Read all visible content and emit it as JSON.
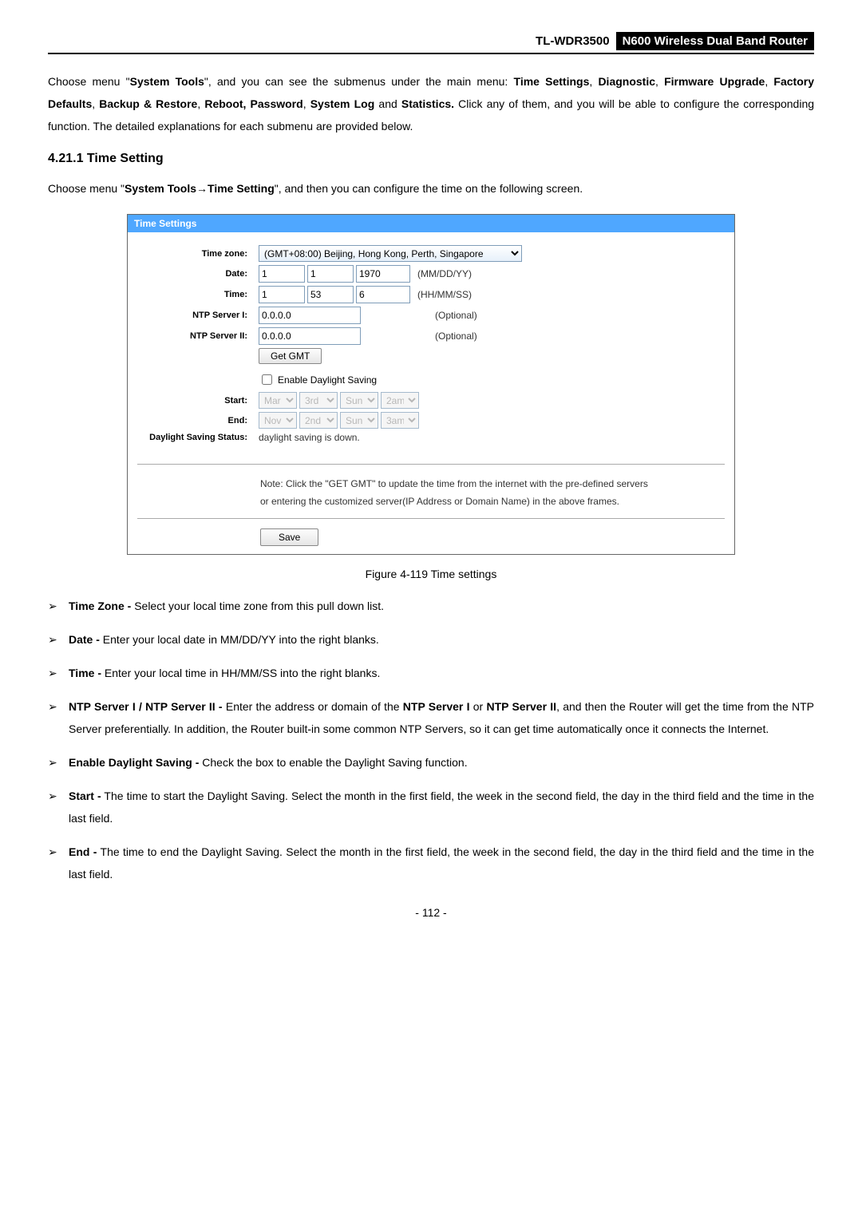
{
  "header": {
    "model": "TL-WDR3500",
    "product": "N600 Wireless Dual Band Router"
  },
  "intro": {
    "p1_a": "Choose menu \"",
    "p1_b": "System Tools",
    "p1_c": "\", and you can see the submenus under the main menu: ",
    "p1_d": "Time Settings",
    "p1_e": ", ",
    "p1_f": "Diagnostic",
    "p1_g": ", ",
    "p1_h": "Firmware Upgrade",
    "p1_i": ", ",
    "p1_j": "Factory Defaults",
    "p1_k": ", ",
    "p1_l": "Backup & Restore",
    "p1_m": ", ",
    "p1_n": "Reboot, Password",
    "p1_o": ", ",
    "p1_p": "System Log",
    "p1_q": " and ",
    "p1_r": "Statistics.",
    "p1_s": " Click any of them, and you will be able to configure the corresponding function. The detailed explanations for each submenu are provided below."
  },
  "section_heading": "4.21.1  Time Setting",
  "intro2_a": "Choose menu \"",
  "intro2_b": "System Tools",
  "intro2_arrow": "→",
  "intro2_c": "Time Setting",
  "intro2_d": "\", and then you can configure the time on the following screen.",
  "form": {
    "title": "Time Settings",
    "labels": {
      "timezone": "Time zone:",
      "date": "Date:",
      "time": "Time:",
      "ntp1": "NTP Server I:",
      "ntp2": "NTP Server II:",
      "start": "Start:",
      "end": "End:",
      "dss": "Daylight Saving Status:"
    },
    "timezone_value": "(GMT+08:00) Beijing, Hong Kong, Perth, Singapore",
    "date_mm": "1",
    "date_dd": "1",
    "date_yy": "1970",
    "date_fmt": "(MM/DD/YY)",
    "time_hh": "1",
    "time_mm": "53",
    "time_ss": "6",
    "time_fmt": "(HH/MM/SS)",
    "ntp1_val": "0.0.0.0",
    "ntp2_val": "0.0.0.0",
    "optional": "(Optional)",
    "get_gmt": "Get GMT",
    "enable_ds": "Enable Daylight Saving",
    "start_vals": {
      "m": "Mar",
      "w": "3rd",
      "d": "Sun",
      "t": "2am"
    },
    "end_vals": {
      "m": "Nov",
      "w": "2nd",
      "d": "Sun",
      "t": "3am"
    },
    "ds_status": "daylight saving is down.",
    "note1": "Note: Click the \"GET GMT\" to update the time from the internet with the pre-defined servers",
    "note2": "or entering the customized server(IP Address or Domain Name) in the above frames.",
    "save": "Save"
  },
  "caption": "Figure 4-119 Time settings",
  "bullets": {
    "b0_a": "Time Zone -",
    "b0_b": " Select your local time zone from this pull down list.",
    "b1_a": "Date -",
    "b1_b": " Enter your local date in MM/DD/YY into the right blanks.",
    "b2_a": "Time -",
    "b2_b": " Enter your local time in HH/MM/SS into the right blanks.",
    "b3_a": "NTP Server I / NTP Server II -",
    "b3_b": " Enter the address or domain of the ",
    "b3_c": "NTP Server I",
    "b3_d": " or ",
    "b3_e": "NTP Server II",
    "b3_f": ", and then the Router will get the time from the NTP Server preferentially. In addition, the Router built-in some common NTP Servers, so it can get time automatically once it connects the Internet.",
    "b4_a": "Enable Daylight Saving -",
    "b4_b": " Check the box to enable the Daylight Saving function.",
    "b5_a": "Start -",
    "b5_b": " The time to start the Daylight Saving. Select the month in the first field, the week in the second field, the day in the third field and the time in the last field.",
    "b6_a": "End -",
    "b6_b": " The time to end the Daylight Saving. Select the month in the first field, the week in the second field, the day in the third field and the time in the last field."
  },
  "page_no": "- 112 -",
  "arrow_glyph": "➢"
}
